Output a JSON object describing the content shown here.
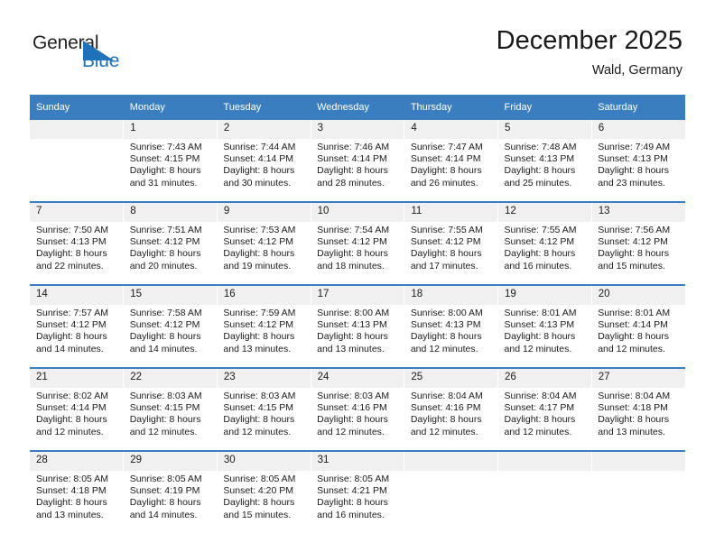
{
  "brand": {
    "name_part1": "General",
    "name_part2": "Blue",
    "accent_color": "#1f72b8"
  },
  "header": {
    "title": "December 2025",
    "subtitle": "Wald, Germany"
  },
  "calendar": {
    "header_bg": "#3a7ebf",
    "daynum_bg": "#f0f0f0",
    "weekday_headers": [
      "Sunday",
      "Monday",
      "Tuesday",
      "Wednesday",
      "Thursday",
      "Friday",
      "Saturday"
    ],
    "weeks": [
      {
        "days": [
          {
            "num": "",
            "sunrise": "",
            "sunset": "",
            "daylight1": "",
            "daylight2": ""
          },
          {
            "num": "1",
            "sunrise": "Sunrise: 7:43 AM",
            "sunset": "Sunset: 4:15 PM",
            "daylight1": "Daylight: 8 hours",
            "daylight2": "and 31 minutes."
          },
          {
            "num": "2",
            "sunrise": "Sunrise: 7:44 AM",
            "sunset": "Sunset: 4:14 PM",
            "daylight1": "Daylight: 8 hours",
            "daylight2": "and 30 minutes."
          },
          {
            "num": "3",
            "sunrise": "Sunrise: 7:46 AM",
            "sunset": "Sunset: 4:14 PM",
            "daylight1": "Daylight: 8 hours",
            "daylight2": "and 28 minutes."
          },
          {
            "num": "4",
            "sunrise": "Sunrise: 7:47 AM",
            "sunset": "Sunset: 4:14 PM",
            "daylight1": "Daylight: 8 hours",
            "daylight2": "and 26 minutes."
          },
          {
            "num": "5",
            "sunrise": "Sunrise: 7:48 AM",
            "sunset": "Sunset: 4:13 PM",
            "daylight1": "Daylight: 8 hours",
            "daylight2": "and 25 minutes."
          },
          {
            "num": "6",
            "sunrise": "Sunrise: 7:49 AM",
            "sunset": "Sunset: 4:13 PM",
            "daylight1": "Daylight: 8 hours",
            "daylight2": "and 23 minutes."
          }
        ]
      },
      {
        "days": [
          {
            "num": "7",
            "sunrise": "Sunrise: 7:50 AM",
            "sunset": "Sunset: 4:13 PM",
            "daylight1": "Daylight: 8 hours",
            "daylight2": "and 22 minutes."
          },
          {
            "num": "8",
            "sunrise": "Sunrise: 7:51 AM",
            "sunset": "Sunset: 4:12 PM",
            "daylight1": "Daylight: 8 hours",
            "daylight2": "and 20 minutes."
          },
          {
            "num": "9",
            "sunrise": "Sunrise: 7:53 AM",
            "sunset": "Sunset: 4:12 PM",
            "daylight1": "Daylight: 8 hours",
            "daylight2": "and 19 minutes."
          },
          {
            "num": "10",
            "sunrise": "Sunrise: 7:54 AM",
            "sunset": "Sunset: 4:12 PM",
            "daylight1": "Daylight: 8 hours",
            "daylight2": "and 18 minutes."
          },
          {
            "num": "11",
            "sunrise": "Sunrise: 7:55 AM",
            "sunset": "Sunset: 4:12 PM",
            "daylight1": "Daylight: 8 hours",
            "daylight2": "and 17 minutes."
          },
          {
            "num": "12",
            "sunrise": "Sunrise: 7:55 AM",
            "sunset": "Sunset: 4:12 PM",
            "daylight1": "Daylight: 8 hours",
            "daylight2": "and 16 minutes."
          },
          {
            "num": "13",
            "sunrise": "Sunrise: 7:56 AM",
            "sunset": "Sunset: 4:12 PM",
            "daylight1": "Daylight: 8 hours",
            "daylight2": "and 15 minutes."
          }
        ]
      },
      {
        "days": [
          {
            "num": "14",
            "sunrise": "Sunrise: 7:57 AM",
            "sunset": "Sunset: 4:12 PM",
            "daylight1": "Daylight: 8 hours",
            "daylight2": "and 14 minutes."
          },
          {
            "num": "15",
            "sunrise": "Sunrise: 7:58 AM",
            "sunset": "Sunset: 4:12 PM",
            "daylight1": "Daylight: 8 hours",
            "daylight2": "and 14 minutes."
          },
          {
            "num": "16",
            "sunrise": "Sunrise: 7:59 AM",
            "sunset": "Sunset: 4:12 PM",
            "daylight1": "Daylight: 8 hours",
            "daylight2": "and 13 minutes."
          },
          {
            "num": "17",
            "sunrise": "Sunrise: 8:00 AM",
            "sunset": "Sunset: 4:13 PM",
            "daylight1": "Daylight: 8 hours",
            "daylight2": "and 13 minutes."
          },
          {
            "num": "18",
            "sunrise": "Sunrise: 8:00 AM",
            "sunset": "Sunset: 4:13 PM",
            "daylight1": "Daylight: 8 hours",
            "daylight2": "and 12 minutes."
          },
          {
            "num": "19",
            "sunrise": "Sunrise: 8:01 AM",
            "sunset": "Sunset: 4:13 PM",
            "daylight1": "Daylight: 8 hours",
            "daylight2": "and 12 minutes."
          },
          {
            "num": "20",
            "sunrise": "Sunrise: 8:01 AM",
            "sunset": "Sunset: 4:14 PM",
            "daylight1": "Daylight: 8 hours",
            "daylight2": "and 12 minutes."
          }
        ]
      },
      {
        "days": [
          {
            "num": "21",
            "sunrise": "Sunrise: 8:02 AM",
            "sunset": "Sunset: 4:14 PM",
            "daylight1": "Daylight: 8 hours",
            "daylight2": "and 12 minutes."
          },
          {
            "num": "22",
            "sunrise": "Sunrise: 8:03 AM",
            "sunset": "Sunset: 4:15 PM",
            "daylight1": "Daylight: 8 hours",
            "daylight2": "and 12 minutes."
          },
          {
            "num": "23",
            "sunrise": "Sunrise: 8:03 AM",
            "sunset": "Sunset: 4:15 PM",
            "daylight1": "Daylight: 8 hours",
            "daylight2": "and 12 minutes."
          },
          {
            "num": "24",
            "sunrise": "Sunrise: 8:03 AM",
            "sunset": "Sunset: 4:16 PM",
            "daylight1": "Daylight: 8 hours",
            "daylight2": "and 12 minutes."
          },
          {
            "num": "25",
            "sunrise": "Sunrise: 8:04 AM",
            "sunset": "Sunset: 4:16 PM",
            "daylight1": "Daylight: 8 hours",
            "daylight2": "and 12 minutes."
          },
          {
            "num": "26",
            "sunrise": "Sunrise: 8:04 AM",
            "sunset": "Sunset: 4:17 PM",
            "daylight1": "Daylight: 8 hours",
            "daylight2": "and 12 minutes."
          },
          {
            "num": "27",
            "sunrise": "Sunrise: 8:04 AM",
            "sunset": "Sunset: 4:18 PM",
            "daylight1": "Daylight: 8 hours",
            "daylight2": "and 13 minutes."
          }
        ]
      },
      {
        "days": [
          {
            "num": "28",
            "sunrise": "Sunrise: 8:05 AM",
            "sunset": "Sunset: 4:18 PM",
            "daylight1": "Daylight: 8 hours",
            "daylight2": "and 13 minutes."
          },
          {
            "num": "29",
            "sunrise": "Sunrise: 8:05 AM",
            "sunset": "Sunset: 4:19 PM",
            "daylight1": "Daylight: 8 hours",
            "daylight2": "and 14 minutes."
          },
          {
            "num": "30",
            "sunrise": "Sunrise: 8:05 AM",
            "sunset": "Sunset: 4:20 PM",
            "daylight1": "Daylight: 8 hours",
            "daylight2": "and 15 minutes."
          },
          {
            "num": "31",
            "sunrise": "Sunrise: 8:05 AM",
            "sunset": "Sunset: 4:21 PM",
            "daylight1": "Daylight: 8 hours",
            "daylight2": "and 16 minutes."
          },
          {
            "num": "",
            "sunrise": "",
            "sunset": "",
            "daylight1": "",
            "daylight2": ""
          },
          {
            "num": "",
            "sunrise": "",
            "sunset": "",
            "daylight1": "",
            "daylight2": ""
          },
          {
            "num": "",
            "sunrise": "",
            "sunset": "",
            "daylight1": "",
            "daylight2": ""
          }
        ]
      }
    ]
  }
}
